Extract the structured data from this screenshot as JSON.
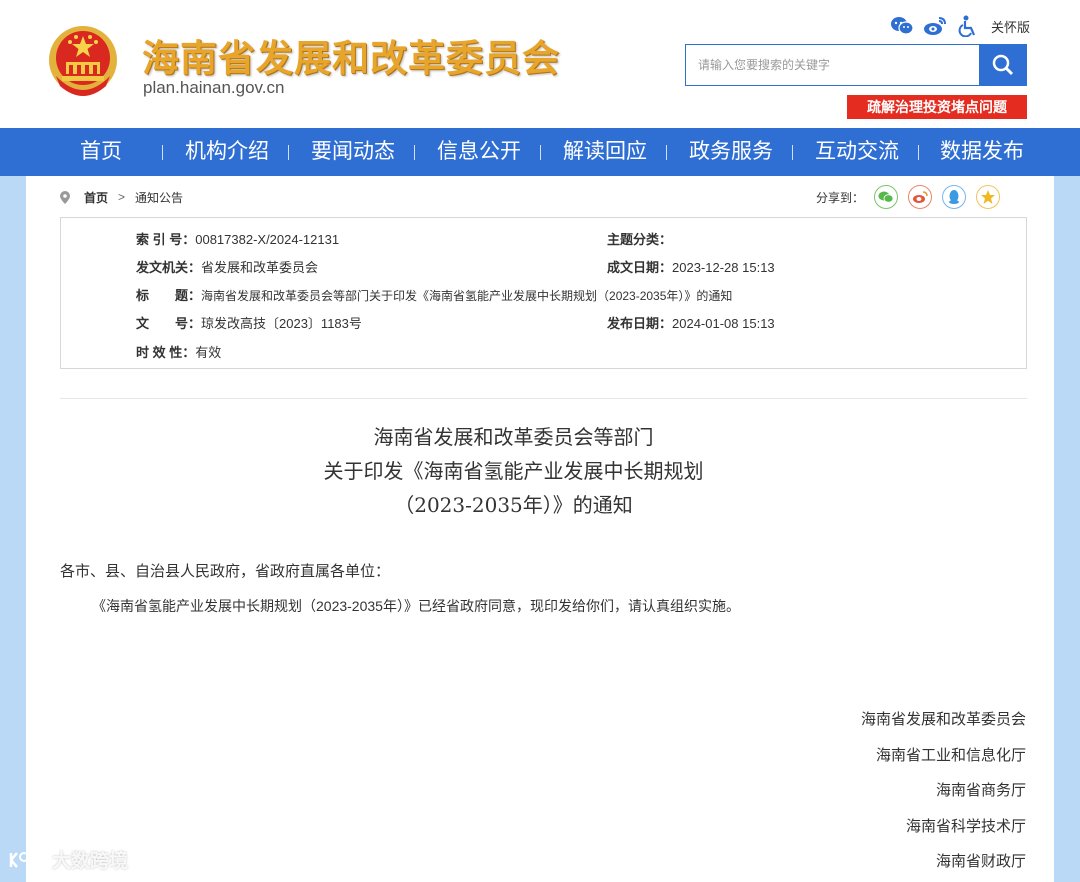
{
  "header": {
    "site_title": "海南省发展和改革委员会",
    "site_domain": "plan.hainan.gov.cn",
    "care_mode": "关怀版",
    "search_placeholder": "请输入您要搜索的关键字",
    "promo_banner": "疏解治理投资堵点问题",
    "icons": [
      "wechat-icon",
      "weibo-icon",
      "accessibility-icon"
    ]
  },
  "nav": {
    "items": [
      "首页",
      "机构介绍",
      "要闻动态",
      "信息公开",
      "解读回应",
      "政务服务",
      "互动交流",
      "数据发布"
    ]
  },
  "breadcrumb": {
    "home": "首页",
    "separator": ">",
    "current": "通知公告"
  },
  "share": {
    "label": "分享到：",
    "icons": [
      "wechat-icon",
      "weibo-icon",
      "qq-icon",
      "qzone-icon"
    ]
  },
  "info": {
    "index_label": "索 引 号：",
    "index_value": "00817382-X/2024-12131",
    "topic_label": "主题分类：",
    "topic_value": "",
    "issuer_label": "发文机关：",
    "issuer_value": "省发展和改革委员会",
    "created_label": "成文日期：",
    "created_value": "2023-12-28 15:13",
    "title_label": "标　　题：",
    "title_value": "海南省发展和改革委员会等部门关于印发《海南省氢能产业发展中长期规划（2023-2035年）》的通知",
    "docno_label": "文　　号：",
    "docno_value": "琼发改高技〔2023〕1183号",
    "published_label": "发布日期：",
    "published_value": "2024-01-08 15:13",
    "validity_label": "时 效 性：",
    "validity_value": "有效"
  },
  "article": {
    "title_lines": [
      "海南省发展和改革委员会等部门",
      "关于印发《海南省氢能产业发展中长期规划",
      "（2023-2035年）》的通知"
    ],
    "salutation": "各市、县、自治县人民政府，省政府直属各单位：",
    "body": "《海南省氢能产业发展中长期规划（2023-2035年）》已经省政府同意，现印发给你们，请认真组织实施。",
    "signatures": [
      "海南省发展和改革委员会",
      "海南省工业和信息化厅",
      "海南省商务厅",
      "海南省科学技术厅",
      "海南省财政厅"
    ]
  },
  "watermark": "大数跨境",
  "colors": {
    "nav_bg": "#2f6fd3",
    "title_gold": "#e7a52b",
    "banner_red": "#e52c21",
    "side_bg": "#b9d9f7"
  }
}
